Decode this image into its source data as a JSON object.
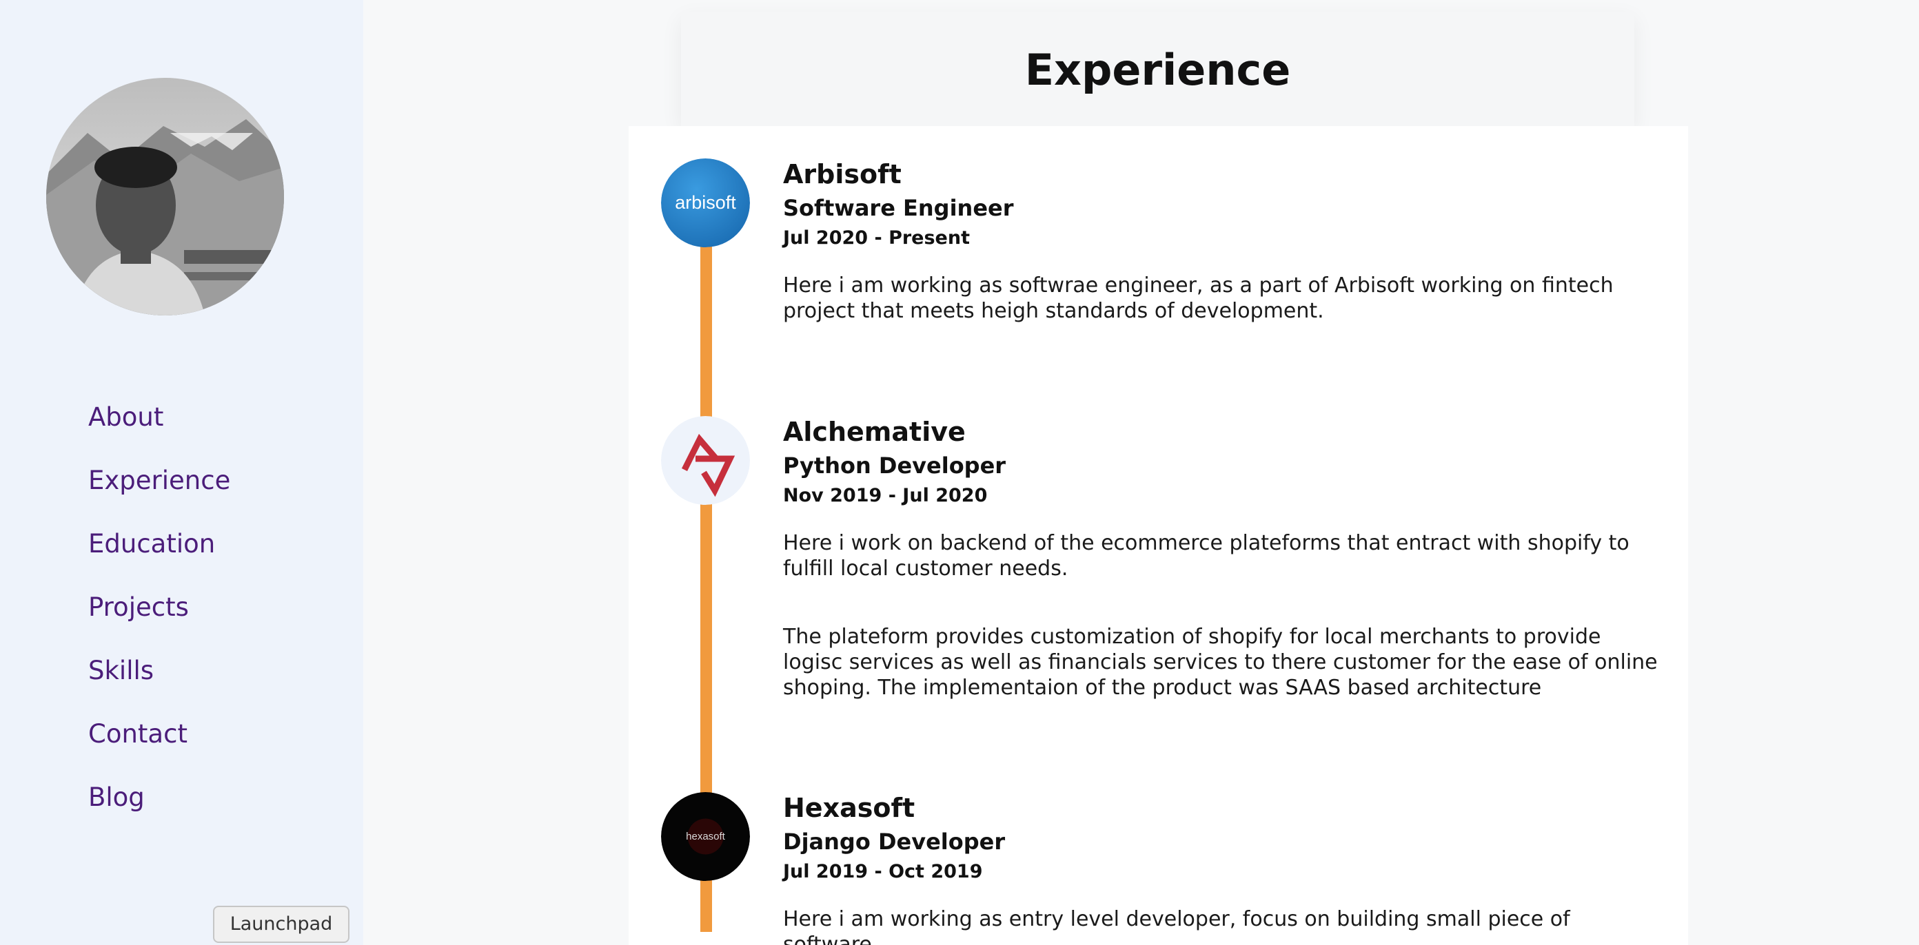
{
  "nav": [
    "About",
    "Experience",
    "Education",
    "Projects",
    "Skills",
    "Contact",
    "Blog"
  ],
  "header": {
    "title": "Experience"
  },
  "experience": [
    {
      "company": "Arbisoft",
      "role": "Software Engineer",
      "dates": "Jul 2020 - Present",
      "logo_text": "arbisoft",
      "paragraphs": [
        "Here i am working as softwrae engineer, as a part of Arbisoft working on fintech project that meets heigh standards of development."
      ]
    },
    {
      "company": "Alchemative",
      "role": "Python Developer",
      "dates": "Nov 2019 - Jul 2020",
      "paragraphs": [
        "Here i work on backend of the ecommerce plateforms that entract with shopify to fulfill local customer needs.",
        "The plateform provides customization of shopify for local merchants to provide logisc services as well as financials services to there customer for the ease of online shoping. The implementaion of the product was SAAS based architecture"
      ]
    },
    {
      "company": "Hexasoft",
      "role": "Django Developer",
      "dates": "Jul 2019 - Oct 2019",
      "logo_text": "hexasoft",
      "paragraphs": [
        "Here i am working as entry level developer, focus on building small piece of software"
      ]
    }
  ],
  "dock": {
    "tooltip": "Launchpad"
  },
  "colors": {
    "timeline": "#f19a3e",
    "nav_link": "#4b1d7a",
    "sidebar_bg": "#eef3fb"
  }
}
